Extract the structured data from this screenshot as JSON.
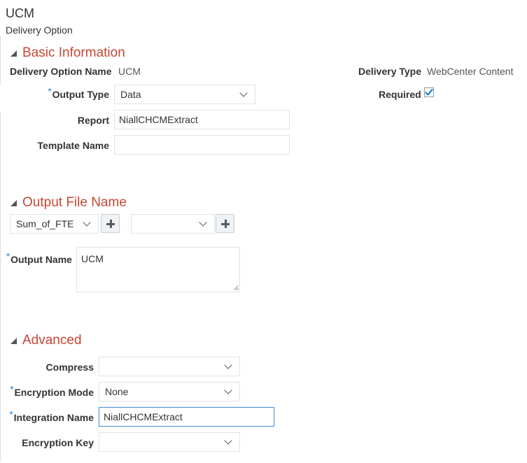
{
  "header": {
    "title": "UCM",
    "subtitle": "Delivery Option"
  },
  "basic_info": {
    "section_title": "Basic Information",
    "delivery_option_name_label": "Delivery Option Name",
    "delivery_option_name_value": "UCM",
    "delivery_type_label": "Delivery Type",
    "delivery_type_value": "WebCenter Content",
    "output_type_label": "Output Type",
    "output_type_value": "Data",
    "required_label": "Required",
    "required_checked": true,
    "report_label": "Report",
    "report_value": "NiallCHCMExtract",
    "template_name_label": "Template Name",
    "template_name_value": ""
  },
  "output_file_name": {
    "section_title": "Output File Name",
    "field_select_value": "Sum_of_FTE",
    "second_select_value": "",
    "output_name_label": "Output Name",
    "output_name_value": "UCM"
  },
  "advanced": {
    "section_title": "Advanced",
    "compress_label": "Compress",
    "compress_value": "",
    "encryption_mode_label": "Encryption Mode",
    "encryption_mode_value": "None",
    "integration_name_label": "Integration Name",
    "integration_name_value": "NiallCHCMExtract",
    "encryption_key_label": "Encryption Key",
    "encryption_key_value": ""
  },
  "required_marker": "*",
  "colors": {
    "section_title": "#c74634",
    "required_marker": "#0572ce",
    "focus_border": "#4a90d9"
  }
}
